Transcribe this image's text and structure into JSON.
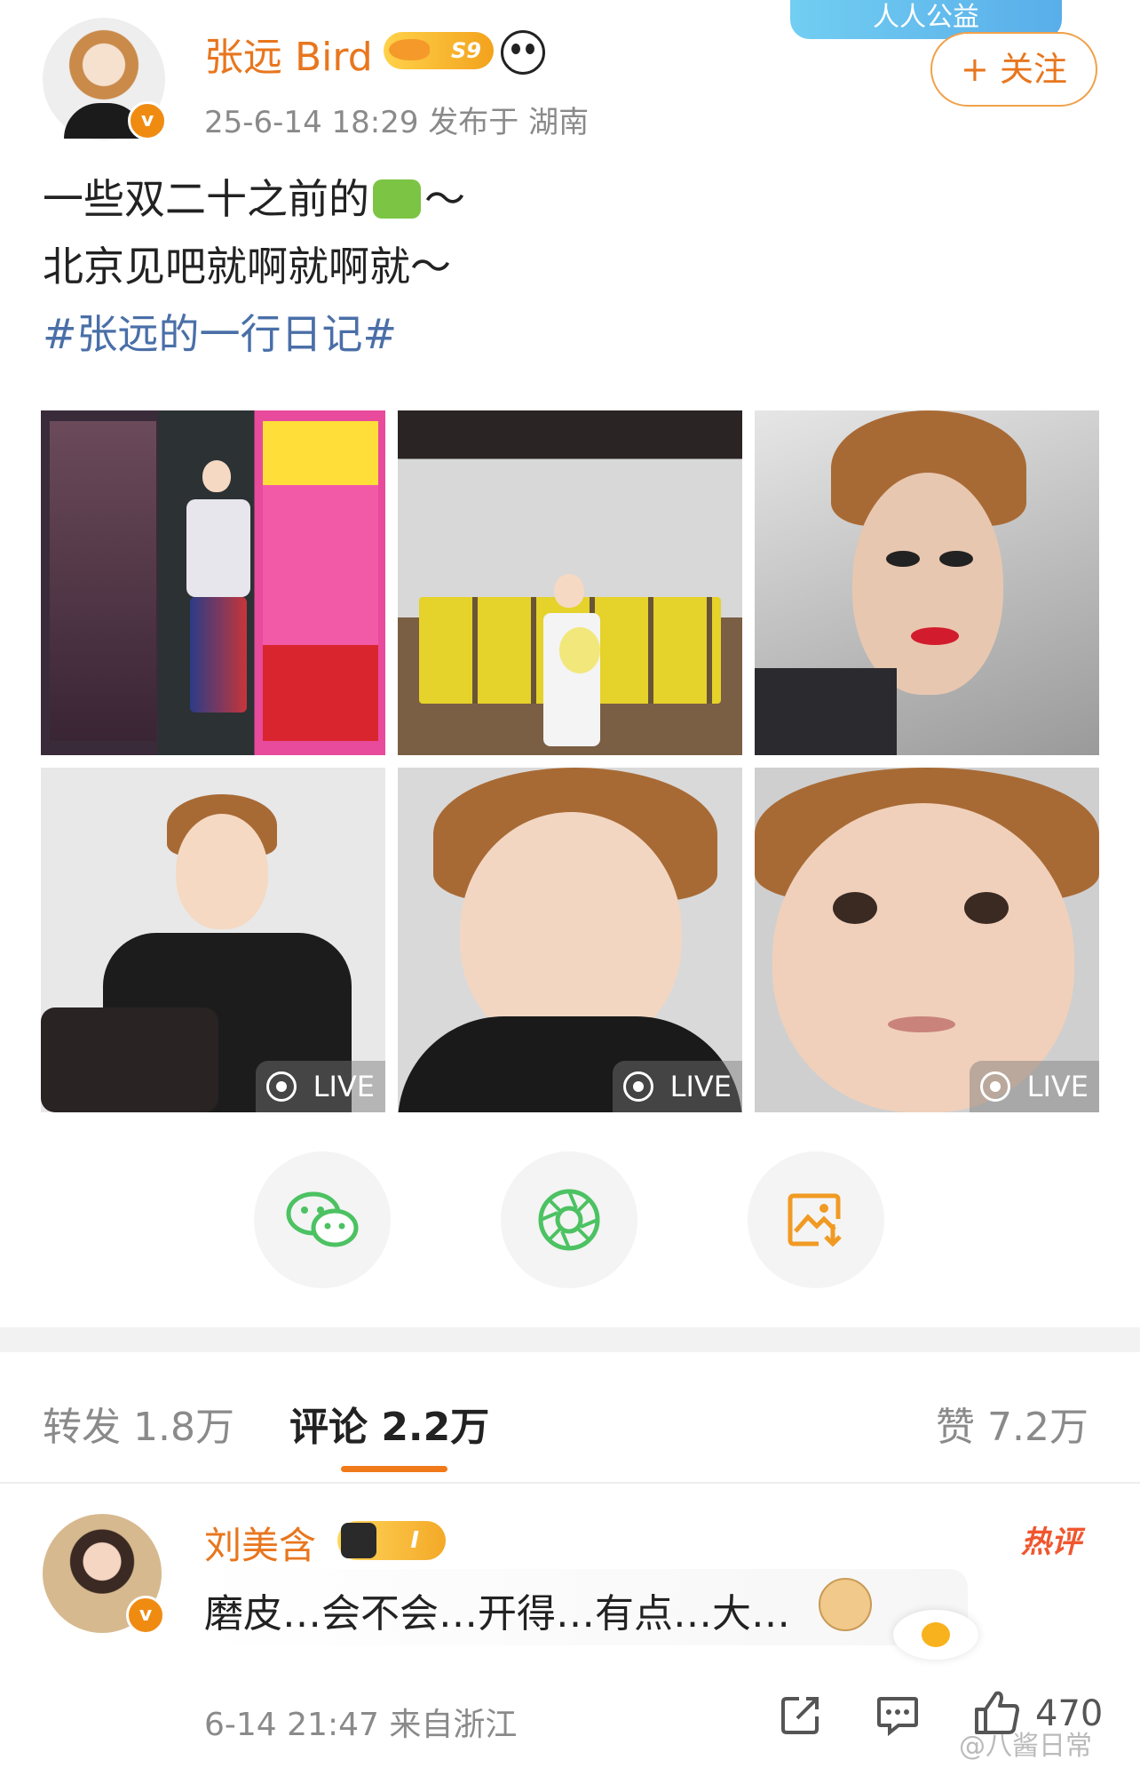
{
  "post": {
    "username": "张远 Bird",
    "level_badge": "S9",
    "meta": "25-6-14 18:29  发布于 湖南",
    "banner": "人人公益",
    "follow_label": "+ 关注",
    "verified_mark": "v",
    "text_line1": "一些双二十之前的",
    "text_line1_tail": "～",
    "text_line2": "北京见吧就啊就啊就～",
    "hashtag": "#张远的一行日记#",
    "live_label": "LIVE"
  },
  "share": {
    "items": [
      "wechat-icon",
      "moments-icon",
      "save-image-icon"
    ]
  },
  "stats": {
    "repost": "转发 1.8万",
    "comments": "评论 2.2万",
    "likes": "赞 7.2万"
  },
  "comment": {
    "username": "刘美含",
    "badge": "I",
    "hot_label": "热评",
    "text": "磨皮…会不会…开得…有点…大…",
    "meta": "6-14 21:47  来自浙江",
    "like_count": "470",
    "verified_mark": "v"
  },
  "watermark": "@八酱日常",
  "colors": {
    "accent": "#e8761e",
    "hashtag": "#4a6fa8",
    "wechat": "#4cc262",
    "underline": "#f07a1a"
  }
}
